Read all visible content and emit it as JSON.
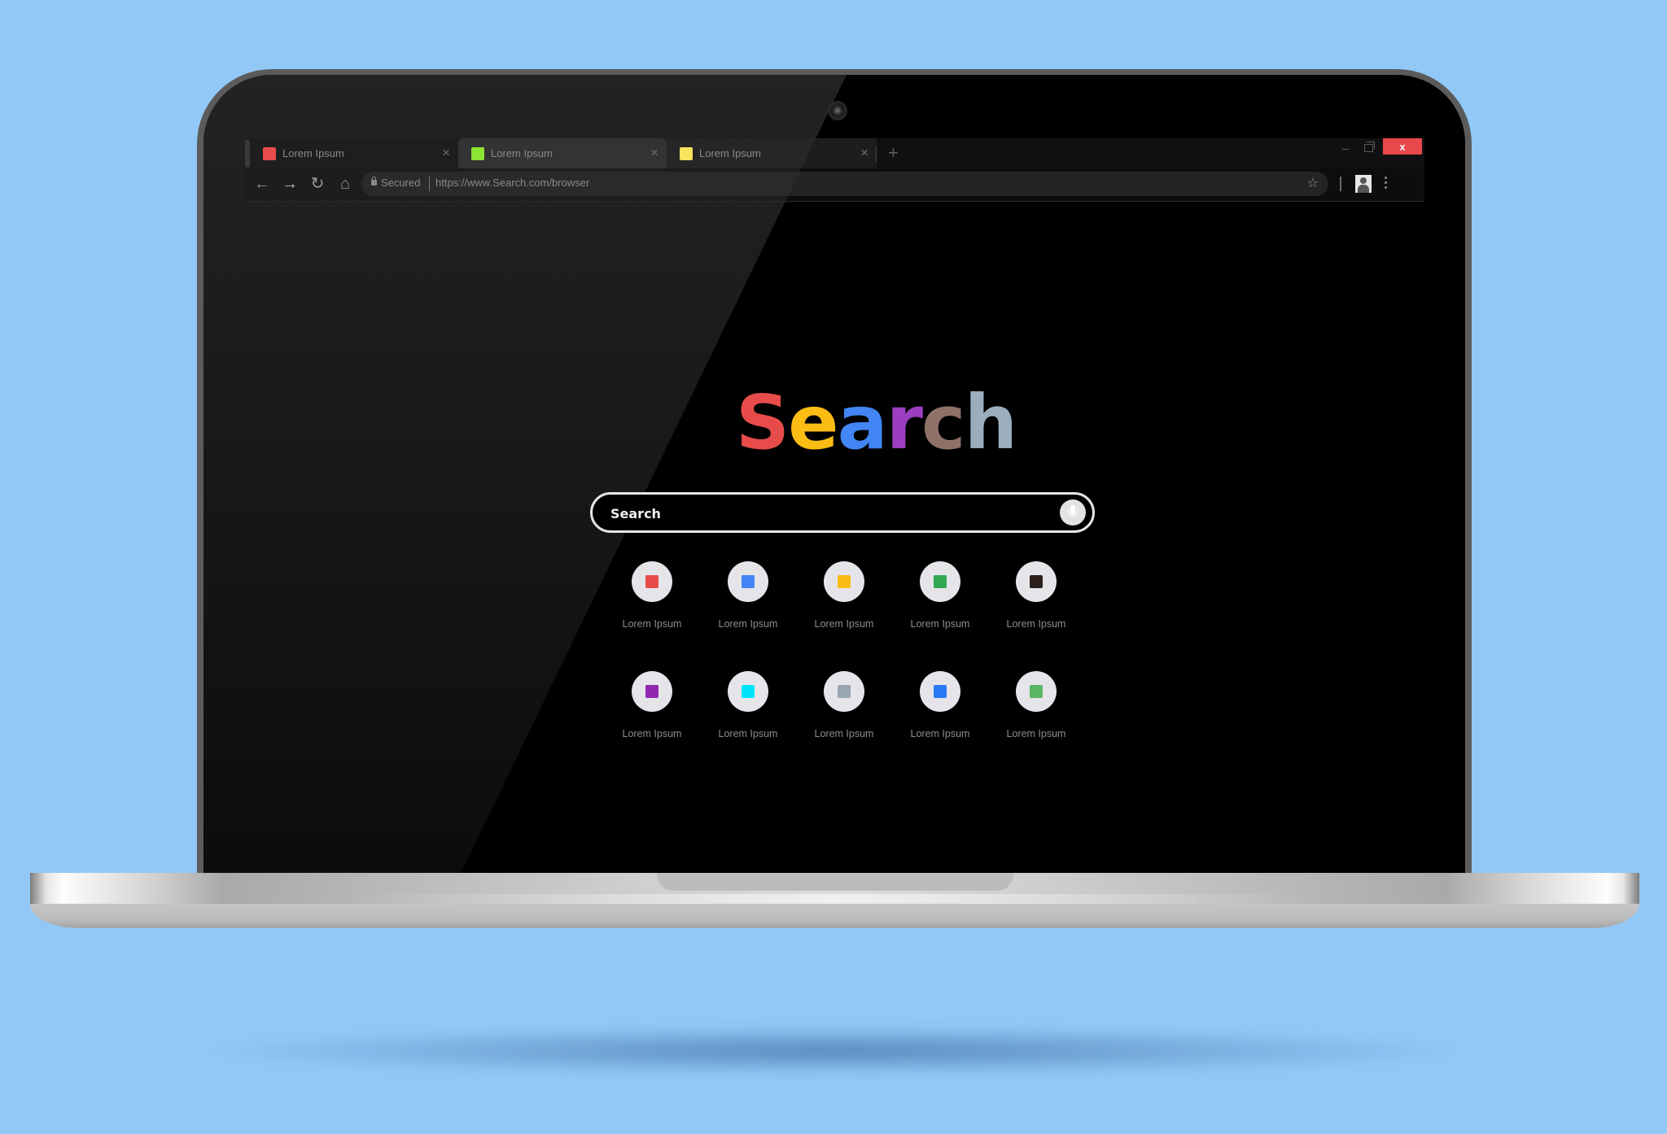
{
  "browser": {
    "tabs": [
      {
        "label": "Lorem Ipsum",
        "favicon_color": "#e84c4a",
        "active": true
      },
      {
        "label": "Lorem Ipsum",
        "favicon_color": "#8de432",
        "active": false
      },
      {
        "label": "Lorem Ipsum",
        "favicon_color": "#f7e35d",
        "active": false
      }
    ],
    "tab_close_glyph": "×",
    "new_tab_glyph": "+",
    "window_controls": {
      "minimize_glyph": "–",
      "close_glyph": "x",
      "close_color": "#e8474b"
    },
    "nav": {
      "back_glyph": "←",
      "forward_glyph": "→",
      "reload_glyph": "↻",
      "home_glyph": "⌂"
    },
    "address_bar": {
      "security_label": "Secured",
      "url": "https://www.Search.com/browser",
      "bookmark_glyph": "☆"
    }
  },
  "page": {
    "logo_letters": [
      {
        "char": "S",
        "color": "#e84c4a"
      },
      {
        "char": "e",
        "color": "#fbbd14"
      },
      {
        "char": "a",
        "color": "#4285f4"
      },
      {
        "char": "r",
        "color": "#9b3fc0"
      },
      {
        "char": "c",
        "color": "#8e7267"
      },
      {
        "char": "h",
        "color": "#9caebb"
      }
    ],
    "search": {
      "placeholder": "Search",
      "value": ""
    },
    "shortcuts": [
      {
        "label": "Lorem Ipsum",
        "color": "#e84c4a"
      },
      {
        "label": "Lorem Ipsum",
        "color": "#4285f4"
      },
      {
        "label": "Lorem Ipsum",
        "color": "#fbbd14"
      },
      {
        "label": "Lorem Ipsum",
        "color": "#33a853"
      },
      {
        "label": "Lorem Ipsum",
        "color": "#2d1f1c"
      },
      {
        "label": "Lorem Ipsum",
        "color": "#9127af"
      },
      {
        "label": "Lorem Ipsum",
        "color": "#00e4fb"
      },
      {
        "label": "Lorem Ipsum",
        "color": "#97a6b2"
      },
      {
        "label": "Lorem Ipsum",
        "color": "#2a79f6"
      },
      {
        "label": "Lorem Ipsum",
        "color": "#5ab564"
      }
    ]
  },
  "colors": {
    "background": "#91c8f6",
    "screen": "#000000",
    "bezel": "#5b5b5b"
  }
}
